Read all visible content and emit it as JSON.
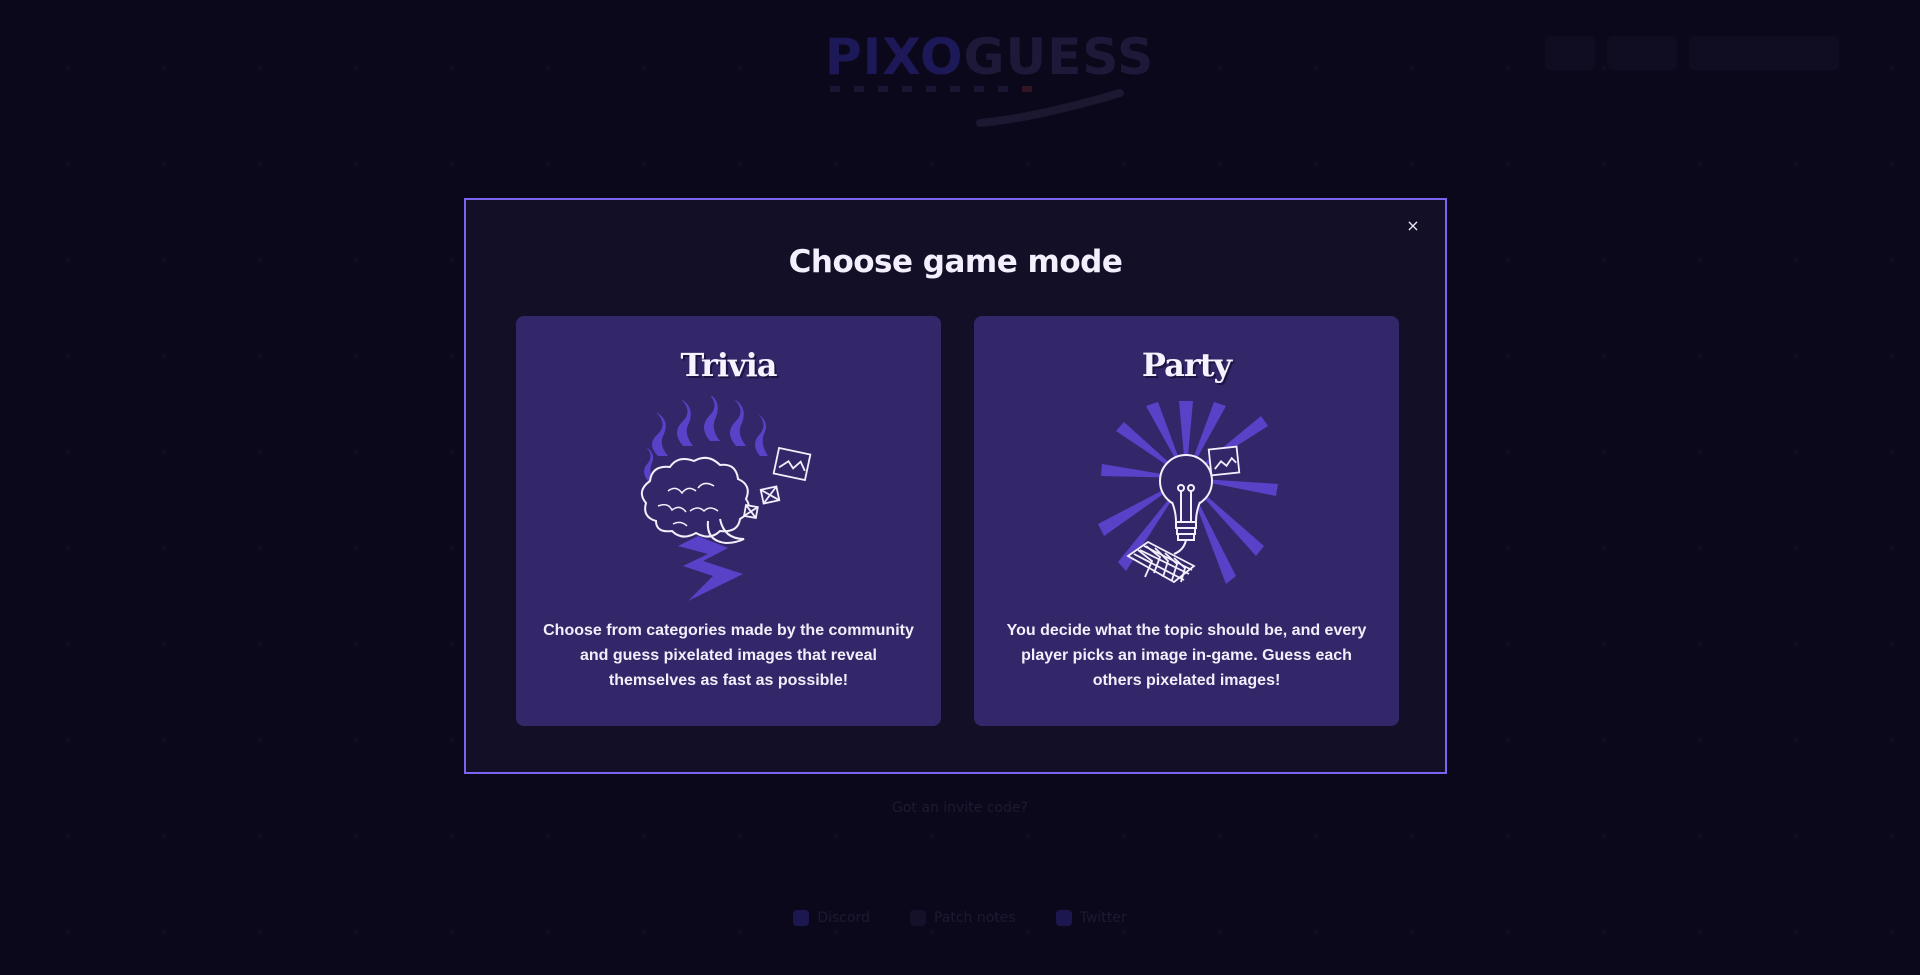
{
  "background": {
    "logo_word_part1": "PIXO",
    "logo_word_part2": "GUESS",
    "bottom_link": "Got an invite code?",
    "footer": [
      {
        "label": "Discord"
      },
      {
        "label": "Patch notes"
      },
      {
        "label": "Twitter"
      }
    ]
  },
  "modal": {
    "title": "Choose game mode",
    "close_glyph": "×",
    "modes": [
      {
        "title": "Trivia",
        "description": "Choose from categories made by the community and guess pixelated images that reveal themselves as fast as possible!",
        "icon": "brain-lightning-icon"
      },
      {
        "title": "Party",
        "description": "You decide what the topic should be, and every player picks an image in-game. Guess each others pixelated images!",
        "icon": "lightbulb-keyboard-icon"
      }
    ]
  },
  "colors": {
    "modal_border": "#7b64f0",
    "modal_bg": "#130f27",
    "card_bg": "#342769",
    "art_accent": "#5a42c8"
  }
}
